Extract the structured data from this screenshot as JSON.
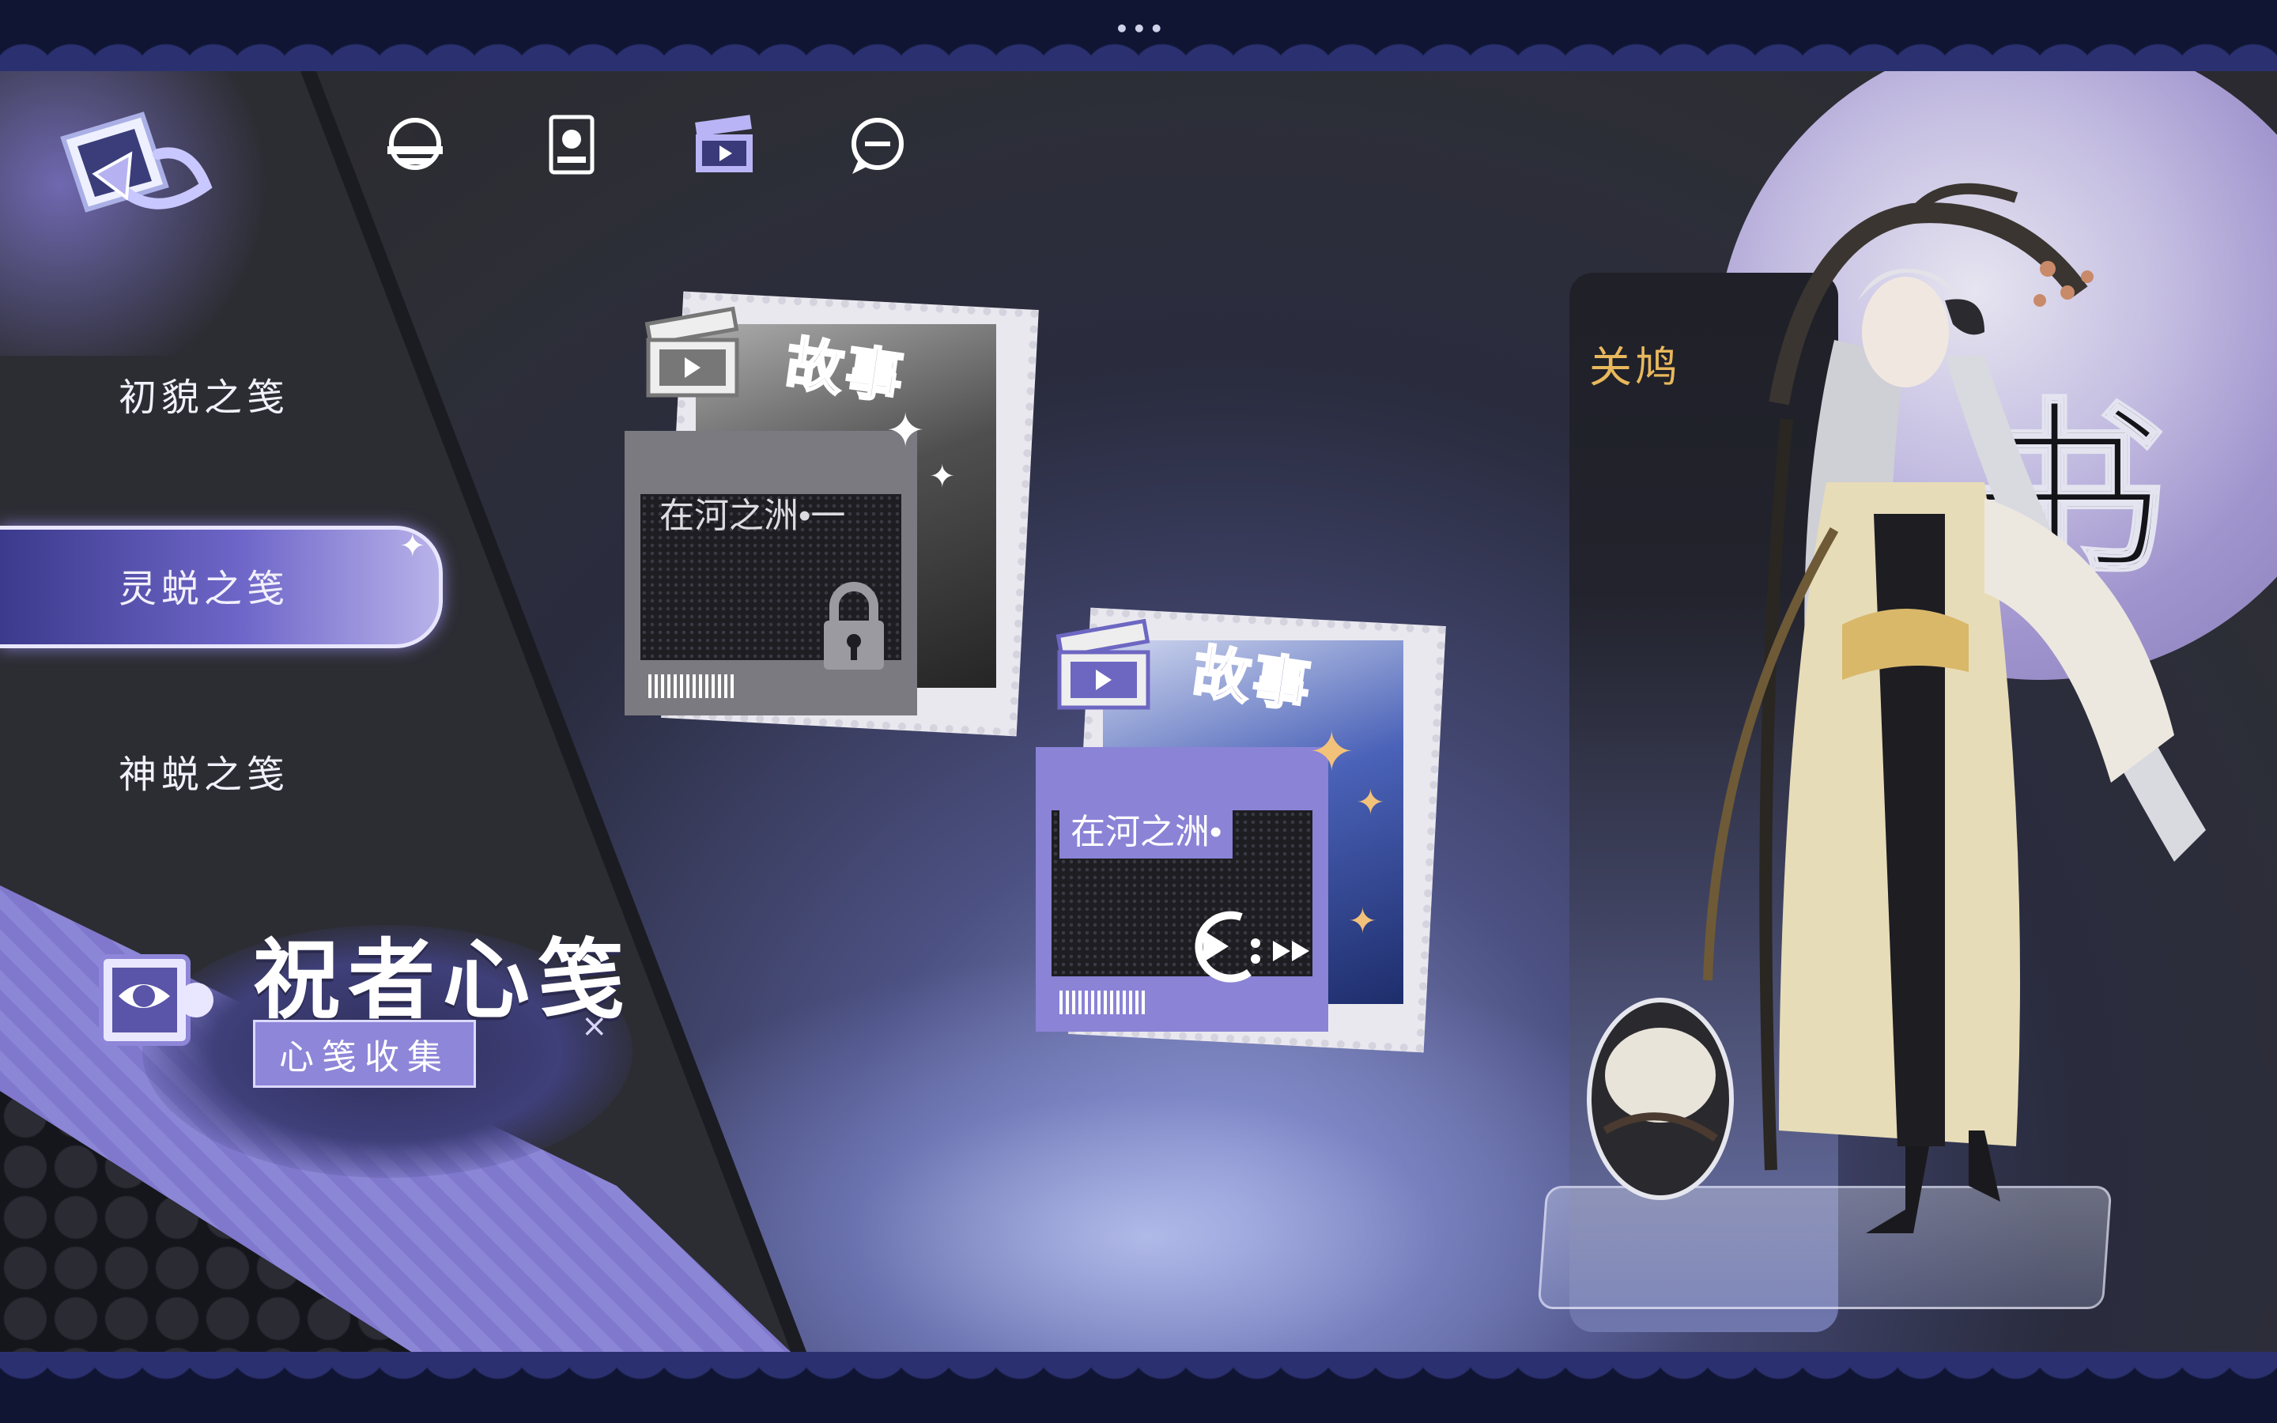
{
  "topbar": {
    "menu_dots": "•••"
  },
  "nav": {
    "icons": [
      {
        "name": "moon-emblem-icon"
      },
      {
        "name": "portrait-card-icon"
      },
      {
        "name": "clapperboard-icon",
        "active": true
      },
      {
        "name": "chat-bubble-icon"
      }
    ]
  },
  "sidebar": {
    "items": [
      {
        "label": "初貌之笺",
        "active": false
      },
      {
        "label": "灵蜕之笺",
        "active": true
      },
      {
        "label": "神蜕之笺",
        "active": false
      }
    ]
  },
  "logo": {
    "title": "祝者心笺",
    "subtitle": "心笺收集",
    "close_glyph": "×"
  },
  "stories": [
    {
      "banner": "故事",
      "title": "在河之洲•一",
      "locked": true
    },
    {
      "banner": "故事",
      "title": "在河之洲•",
      "locked": false
    }
  ],
  "character": {
    "name": "关鸠",
    "card_glyph": "书"
  },
  "colors": {
    "accent": "#8e86d8",
    "locked_gray": "#7a7a80",
    "story_purple": "#8a83d6",
    "gold": "#e8b85c"
  }
}
